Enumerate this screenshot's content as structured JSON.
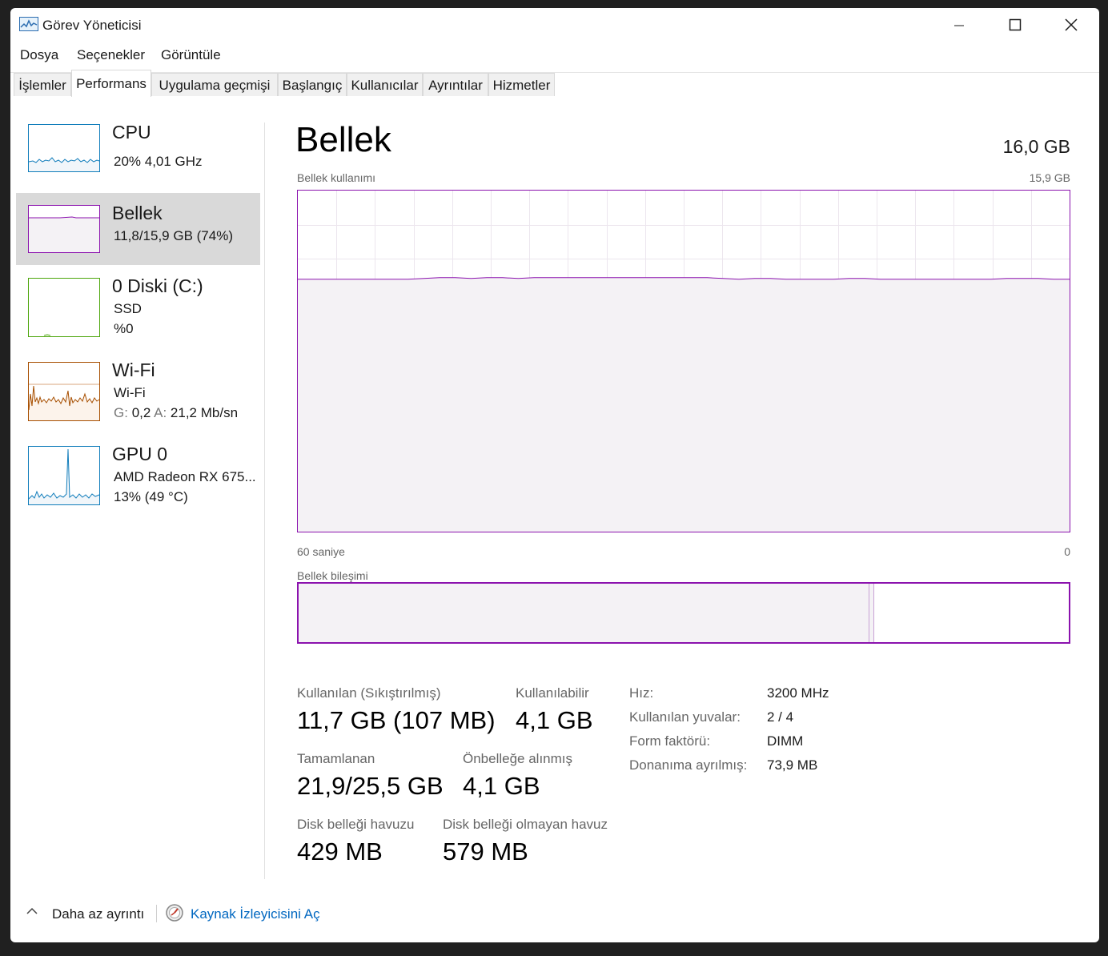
{
  "window": {
    "title": "Görev Yöneticisi",
    "accent": "#8b12ae"
  },
  "menu": [
    "Dosya",
    "Seçenekler",
    "Görüntüle"
  ],
  "tabs": [
    "İşlemler",
    "Performans",
    "Uygulama geçmişi",
    "Başlangıç",
    "Kullanıcılar",
    "Ayrıntılar",
    "Hizmetler"
  ],
  "active_tab": "Performans",
  "sidebar": {
    "cpu": {
      "title": "CPU",
      "sub": "20%  4,01 GHz",
      "color": "#117dbb"
    },
    "memory": {
      "title": "Bellek",
      "sub": "11,8/15,9 GB (74%)",
      "color": "#8b12ae"
    },
    "disk": {
      "title": "0 Diski (C:)",
      "sub1": "SSD",
      "sub2": "%0",
      "color": "#4da60c"
    },
    "wifi": {
      "title": "Wi-Fi",
      "sub1": "Wi-Fi",
      "send_label": "G:",
      "send_value": "0,2",
      "recv_label": "A:",
      "recv_value": "21,2 Mb/sn",
      "color": "#a74f01"
    },
    "gpu": {
      "title": "GPU 0",
      "sub1": "AMD Radeon RX 675...",
      "sub2": "13%  (49 °C)",
      "color": "#117dbb"
    }
  },
  "main": {
    "title": "Bellek",
    "total": "16,0 GB",
    "usage_label": "Bellek kullanımı",
    "usage_max": "15,9 GB",
    "time_left": "60 saniye",
    "time_right": "0",
    "usage_fraction": 0.74,
    "composition_label": "Bellek bileşimi",
    "composition": {
      "in_use_fraction": 0.74,
      "modified_fraction": 0.007
    }
  },
  "stats": {
    "used_label": "Kullanılan (Sıkıştırılmış)",
    "used_value": "11,7 GB (107 MB)",
    "available_label": "Kullanılabilir",
    "available_value": "4,1 GB",
    "committed_label": "Tamamlanan",
    "committed_value": "21,9/25,5 GB",
    "cached_label": "Önbelleğe alınmış",
    "cached_value": "4,1 GB",
    "paged_label": "Disk belleği havuzu",
    "paged_value": "429 MB",
    "nonpaged_label": "Disk belleği olmayan havuz",
    "nonpaged_value": "579 MB"
  },
  "details": [
    {
      "key": "Hız:",
      "value": "3200 MHz"
    },
    {
      "key": "Kullanılan yuvalar:",
      "value": "2 / 4"
    },
    {
      "key": "Form faktörü:",
      "value": "DIMM"
    },
    {
      "key": "Donanıma ayrılmış:",
      "value": "73,9 MB"
    }
  ],
  "footer": {
    "less_details": "Daha az ayrıntı",
    "resource_monitor": "Kaynak İzleyicisini Aç"
  }
}
